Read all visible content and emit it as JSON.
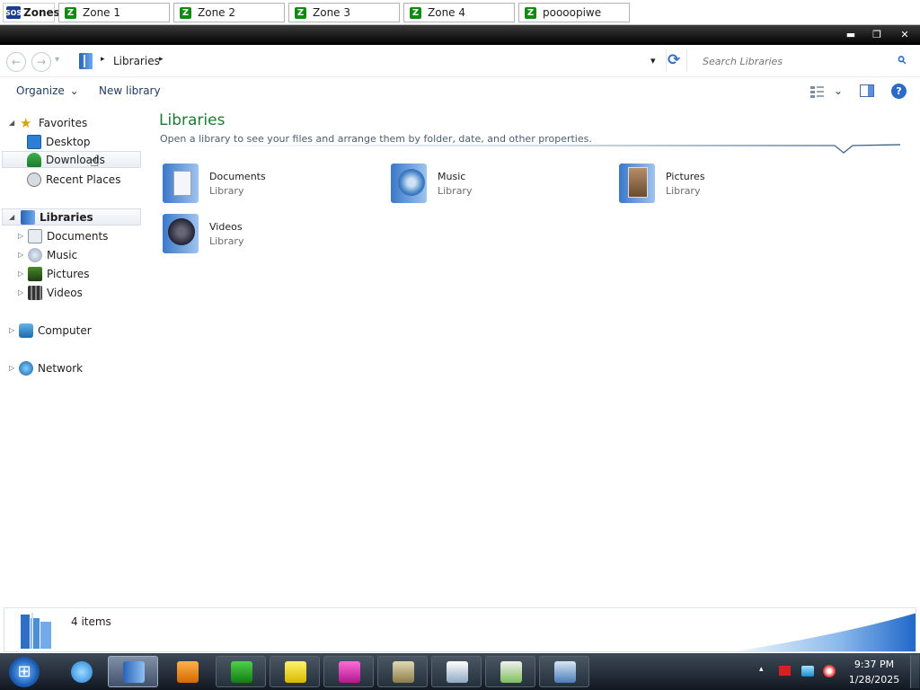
{
  "zones": {
    "app_label": "Zones",
    "app_icon_text": "SOS",
    "tabs": [
      {
        "label": "Zone 1",
        "icon_text": "Z"
      },
      {
        "label": "Zone 2",
        "icon_text": "Z"
      },
      {
        "label": "Zone 3",
        "icon_text": "Z"
      },
      {
        "label": "Zone 4",
        "icon_text": "Z"
      },
      {
        "label": "poooopiwe",
        "icon_text": "Z"
      }
    ]
  },
  "window": {
    "minimize": "▬",
    "restore": "❐",
    "close": "✕"
  },
  "address": {
    "back": "←",
    "forward": "→",
    "dropdown": "▾",
    "sep": "▸",
    "breadcrumb": "Libraries",
    "history_dropdown": "▾",
    "refresh": "⟳",
    "search_placeholder": "Search Libraries",
    "search_glyph": "⌕"
  },
  "toolbar": {
    "organize": "Organize",
    "organize_arrow": "⌄",
    "new_library": "New library",
    "view_arrow": "⌄",
    "help": "?"
  },
  "nav": {
    "expanded": "◢",
    "collapsed": "▷",
    "favorites": {
      "label": "Favorites",
      "items": [
        "Desktop",
        "Downloads",
        "Recent Places"
      ]
    },
    "libraries": {
      "label": "Libraries",
      "items": [
        "Documents",
        "Music",
        "Pictures",
        "Videos"
      ]
    },
    "computer": "Computer",
    "network": "Network"
  },
  "main": {
    "title": "Libraries",
    "subtitle": "Open a library to see your files and arrange them by folder, date, and other properties.",
    "tiles": [
      {
        "name": "Documents",
        "type": "Library"
      },
      {
        "name": "Music",
        "type": "Library"
      },
      {
        "name": "Pictures",
        "type": "Library"
      },
      {
        "name": "Videos",
        "type": "Library"
      }
    ]
  },
  "details": {
    "count": "4 items"
  },
  "taskbar": {
    "start_glyph": "⊞",
    "tray_arrow": "▴",
    "time": "9:37 PM",
    "date": "1/28/2025"
  },
  "colors": {
    "title_green": "#1e7a33",
    "link_blue": "#1e395b",
    "taskbar": "#1b2530"
  }
}
